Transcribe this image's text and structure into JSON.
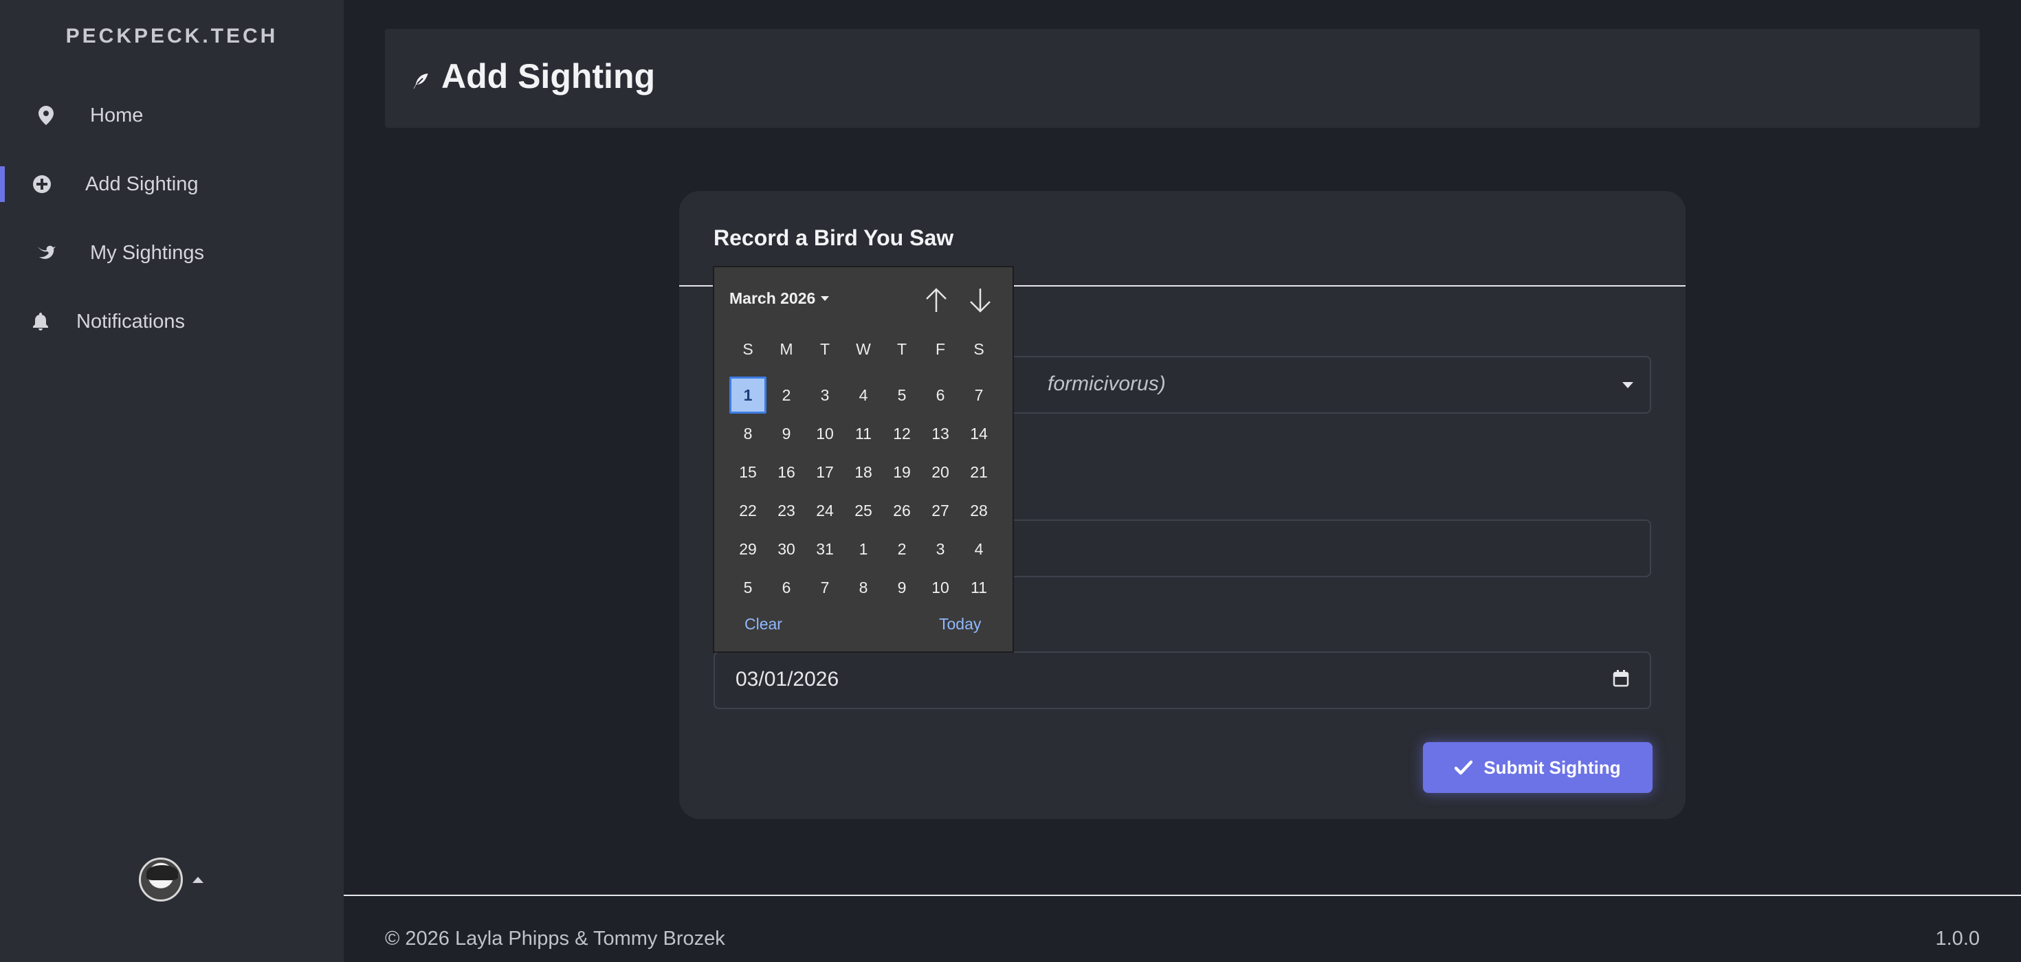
{
  "sidebar": {
    "brand": "PECKPECK.TECH",
    "items": [
      {
        "label": "Home",
        "icon": "map-pin-icon"
      },
      {
        "label": "Add Sighting",
        "icon": "plus-circle-icon",
        "active": true
      },
      {
        "label": "My Sightings",
        "icon": "bird-icon"
      },
      {
        "label": "Notifications",
        "icon": "bell-icon"
      }
    ]
  },
  "header": {
    "title": "Add Sighting",
    "icon": "feather-icon"
  },
  "form": {
    "title": "Record a Bird You Saw",
    "species_value_visible": "formicivorus)",
    "location_value": "",
    "date_value": "03/01/2026",
    "submit_label": "Submit Sighting"
  },
  "datepicker": {
    "month_label": "March 2026",
    "weekdays": [
      "S",
      "M",
      "T",
      "W",
      "T",
      "F",
      "S"
    ],
    "weeks": [
      [
        "1",
        "2",
        "3",
        "4",
        "5",
        "6",
        "7"
      ],
      [
        "8",
        "9",
        "10",
        "11",
        "12",
        "13",
        "14"
      ],
      [
        "15",
        "16",
        "17",
        "18",
        "19",
        "20",
        "21"
      ],
      [
        "22",
        "23",
        "24",
        "25",
        "26",
        "27",
        "28"
      ],
      [
        "29",
        "30",
        "31",
        "1",
        "2",
        "3",
        "4"
      ],
      [
        "5",
        "6",
        "7",
        "8",
        "9",
        "10",
        "11"
      ]
    ],
    "selected": "1",
    "clear_label": "Clear",
    "today_label": "Today"
  },
  "footer": {
    "copyright": "© 2026 Layla Phipps & Tommy Brozek",
    "version": "1.0.0"
  },
  "colors": {
    "accent": "#6c73e6",
    "background": "#1f2128",
    "panel": "#2b2d35",
    "picker_bg": "#3b3b3b",
    "selected_day": "#a9c7f5"
  }
}
